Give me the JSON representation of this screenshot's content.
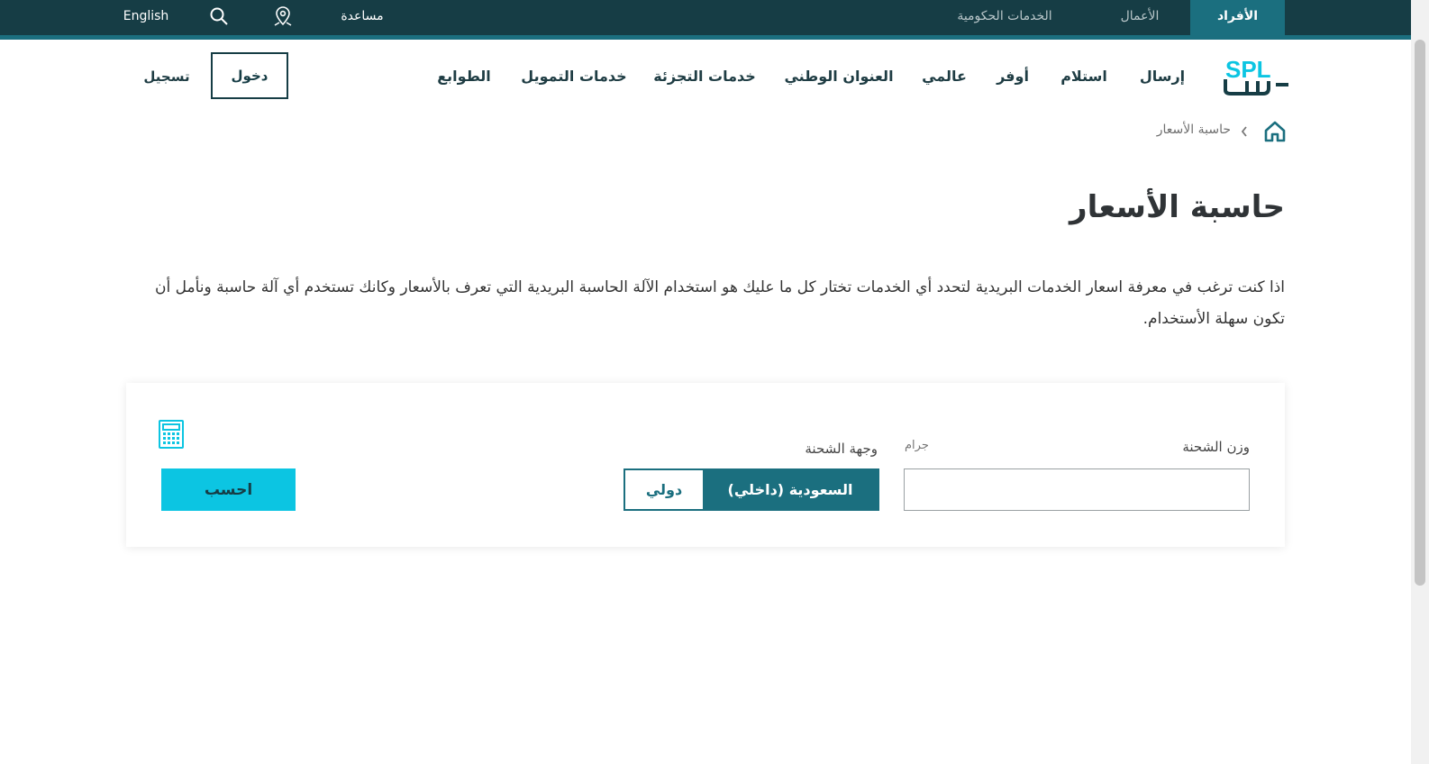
{
  "topbar": {
    "tabs": [
      {
        "label": "الأفراد",
        "active": true
      },
      {
        "label": "الأعمال",
        "active": false
      },
      {
        "label": "الخدمات الحكومية",
        "active": false
      }
    ],
    "help_label": "مساعدة",
    "lang_label": "English"
  },
  "header": {
    "logo_text": "SPL",
    "nav": [
      {
        "label": "إرسال"
      },
      {
        "label": "استلام"
      },
      {
        "label": "أوفر"
      },
      {
        "label": "عالمي"
      },
      {
        "label": "العنوان الوطني"
      },
      {
        "label": "خدمات التجزئة"
      },
      {
        "label": "خدمات التمويل"
      },
      {
        "label": "الطوابع"
      }
    ],
    "login_label": "دخول",
    "register_label": "تسجيل"
  },
  "breadcrumb": {
    "current": "حاسبة الأسعار"
  },
  "main": {
    "title": "حاسبة الأسعار",
    "description": "اذا كنت ترغب في معرفة اسعار الخدمات البريدية لتحدد أي الخدمات تختار كل ما عليك هو استخدام الآلة الحاسبة البريدية التي تعرف بالأسعار وكانك تستخدم أي آلة حاسبة ونأمل أن تكون سهلة الأستخدام."
  },
  "calculator": {
    "weight_label": "وزن الشحنة",
    "weight_unit": "جرام",
    "weight_value": "",
    "destination_label": "وجهة الشحنة",
    "domestic_label": "السعودية (داخلي)",
    "international_label": "دولي",
    "calculate_label": "احسب"
  },
  "colors": {
    "topbar": "#163d45",
    "accent": "#1b6f7f",
    "calc_button": "#0cc5e2"
  }
}
